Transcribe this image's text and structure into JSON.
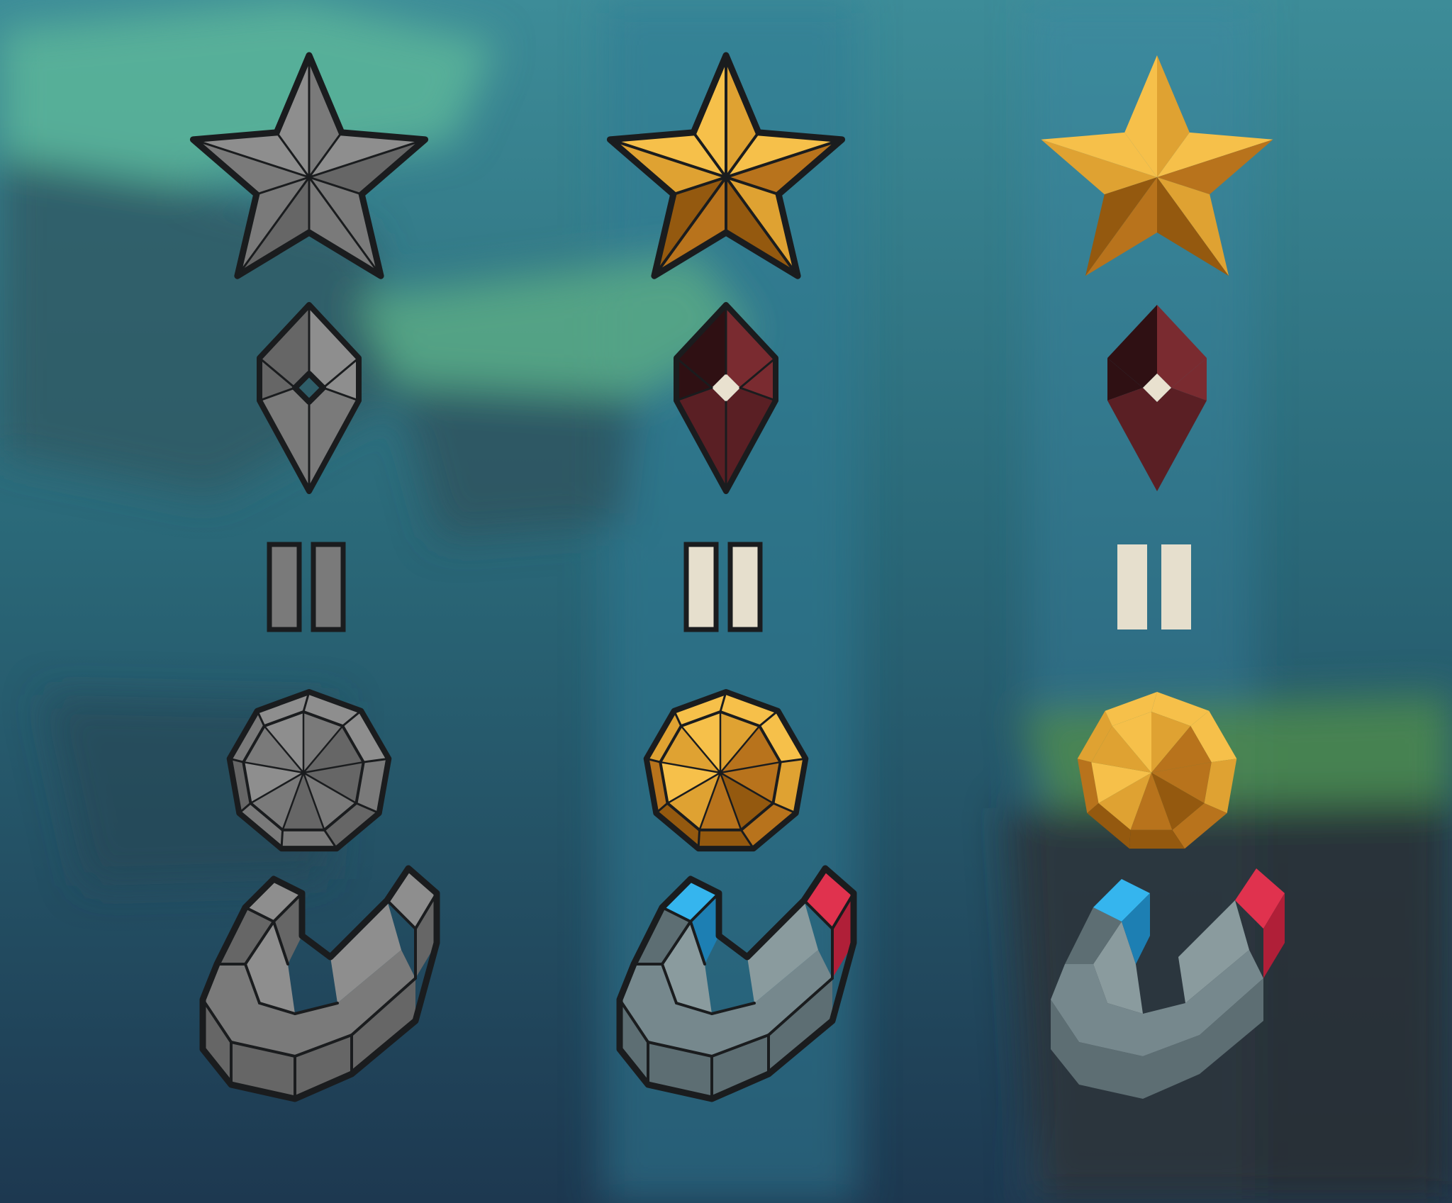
{
  "stages": [
    {
      "name": "sketch",
      "outlined": true
    },
    {
      "name": "inked-color",
      "outlined": true
    },
    {
      "name": "final-flat",
      "outlined": false
    }
  ],
  "icons": [
    "star-icon",
    "gem-icon",
    "pause-icon",
    "coin-icon",
    "magnet-icon"
  ],
  "palette": {
    "sketch_fill": "#7a7a7a",
    "sketch_light": "#8e8e8e",
    "sketch_dark": "#666666",
    "ink": "#1a1c1e",
    "gold_light": "#f6c04a",
    "gold_mid": "#dfa232",
    "gold_dark": "#b8731c",
    "gold_deep": "#94590f",
    "gem_light": "#7a2b30",
    "gem_mid": "#5a1f24",
    "gem_dark": "#2f1013",
    "gem_core": "#e9e1cf",
    "pause_fill": "#e6dfcd",
    "magnet_body": "#76888d",
    "magnet_body_light": "#8a9b9e",
    "magnet_body_dark": "#5d6e73",
    "magnet_blue": "#35b5ee",
    "magnet_blue_dark": "#1d7fb3",
    "magnet_red": "#e0324e",
    "magnet_red_dark": "#b01f38",
    "bg_top": "#3e8e9e",
    "bg_bottom": "#1e3a52"
  }
}
